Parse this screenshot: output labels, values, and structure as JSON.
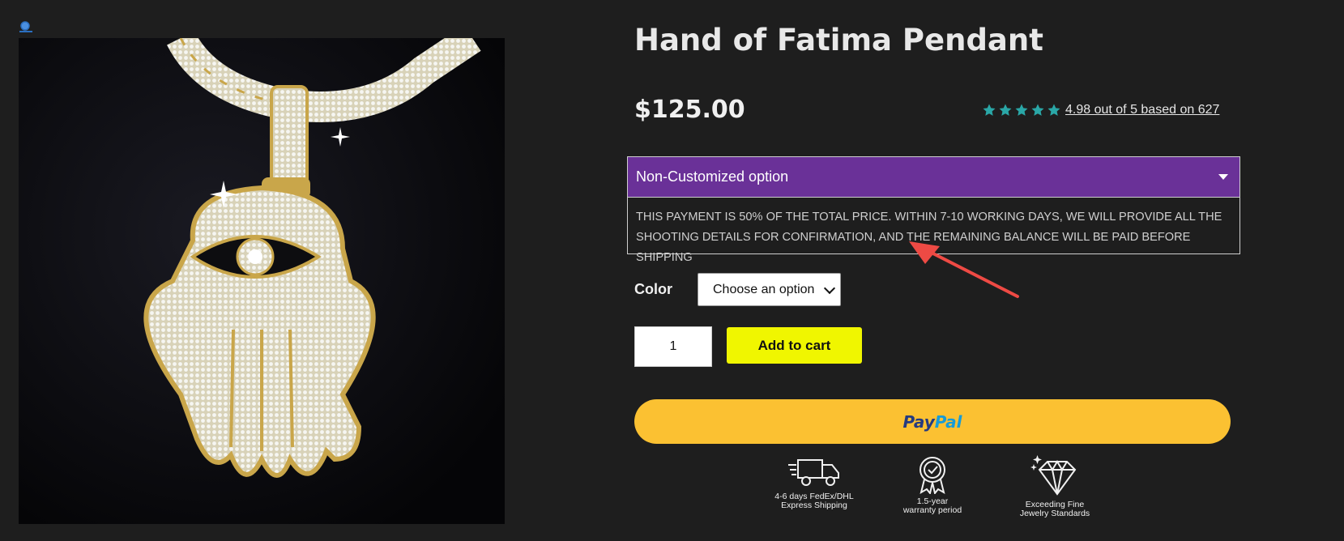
{
  "product": {
    "title": "Hand of Fatima Pendant",
    "price": "$125.00",
    "rating_text": "4.98 out of 5 based on 627",
    "rating_value": 4.98,
    "rating_max": 5
  },
  "option": {
    "label": "Non-Customized option",
    "description": "This payment is 50% of the total price. Within 7-10 working days, we will provide all the shooting details for confirmation, and the remaining balance will be paid before shipping"
  },
  "color": {
    "label": "Color",
    "selected": "Choose an option"
  },
  "cart": {
    "quantity": "1",
    "add_label": "Add to cart"
  },
  "paypal": {
    "part1": "Pay",
    "part2": "Pal"
  },
  "features": [
    {
      "line1": "4-6 days FedEx/DHL",
      "line2": "Express Shipping",
      "icon": "truck-icon"
    },
    {
      "line1": "1.5-year",
      "line2": "warranty period",
      "icon": "badge-check-icon"
    },
    {
      "line1": "Exceeding Fine",
      "line2": "Jewelry Standards",
      "icon": "diamond-icon"
    }
  ],
  "colors": {
    "background": "#1e1e1e",
    "option_header": "#6a3198",
    "star": "#2aa7a7",
    "add_to_cart": "#f0f600",
    "paypal": "#fbc132",
    "annotation_arrow": "#ee4a44"
  }
}
